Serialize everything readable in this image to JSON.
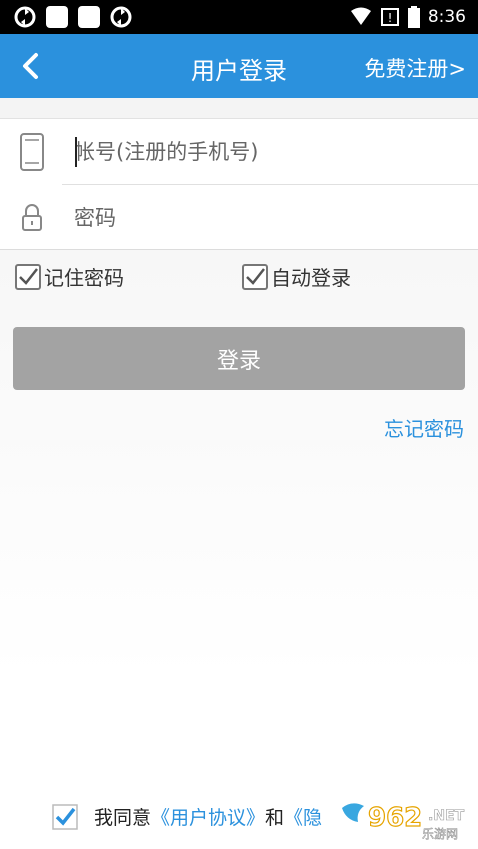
{
  "status_bar": {
    "time": "8:36"
  },
  "header": {
    "title": "用户登录",
    "register_link": "免费注册>"
  },
  "form": {
    "account_placeholder": "帐号(注册的手机号)",
    "password_placeholder": "密码"
  },
  "options": {
    "remember_password": "记住密码",
    "auto_login": "自动登录"
  },
  "actions": {
    "login_button": "登录",
    "forgot_password": "忘记密码"
  },
  "agreement": {
    "prefix": "我同意",
    "user_agreement": "《用户协议》",
    "and": "和",
    "privacy_partial": "《隐"
  },
  "watermark": {
    "brand": "962",
    "suffix": ".NET",
    "subtitle": "乐游网"
  },
  "colors": {
    "accent": "#2b91dd",
    "button_disabled": "#a3a3a3"
  }
}
